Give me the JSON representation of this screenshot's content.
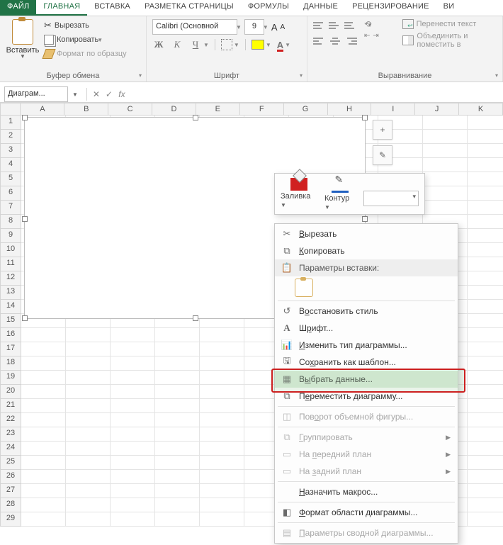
{
  "tabs": {
    "file": "ФАЙЛ",
    "home": "ГЛАВНАЯ",
    "insert": "ВСТАВКА",
    "layout": "РАЗМЕТКА СТРАНИЦЫ",
    "formulas": "ФОРМУЛЫ",
    "data": "ДАННЫЕ",
    "review": "РЕЦЕНЗИРОВАНИЕ",
    "view": "ВИ"
  },
  "ribbon": {
    "clipboard": {
      "paste": "Вставить",
      "cut": "Вырезать",
      "copy": "Копировать",
      "format_painter": "Формат по образцу",
      "group_label": "Буфер обмена"
    },
    "font": {
      "name": "Calibri (Основной",
      "size": "9",
      "group_label": "Шрифт",
      "bold": "Ж",
      "italic": "К",
      "underline": "Ч",
      "grow": "A",
      "shrink": "A",
      "color_letter": "А"
    },
    "align": {
      "wrap": "Перенести текст",
      "merge": "Объединить и поместить в",
      "group_label": "Выравнивание"
    }
  },
  "formula_bar": {
    "namebox": "Диаграм...",
    "fx": "fx"
  },
  "columns": [
    "A",
    "B",
    "C",
    "D",
    "E",
    "F",
    "G",
    "H",
    "I",
    "J",
    "K"
  ],
  "row_count": 29,
  "chart_side": {
    "plus": "+",
    "brush": "✎"
  },
  "mini_toolbar": {
    "fill": "Заливка",
    "outline": "Контур"
  },
  "context_menu": {
    "cut": "Вырезать",
    "copy": "Копировать",
    "paste_options": "Параметры вставки:",
    "reset_style": "Восстановить стиль",
    "font": "Шрифт...",
    "change_chart_type": "Изменить тип диаграммы...",
    "save_template": "Сохранить как шаблон...",
    "select_data": "Выбрать данные...",
    "move_chart": "Переместить диаграмму...",
    "rotate_3d": "Поворот объемной фигуры...",
    "group": "Группировать",
    "bring_front": "На передний план",
    "send_back": "На задний план",
    "assign_macro": "Назначить макрос...",
    "format_chart_area": "Формат области диаграммы...",
    "pivot_chart_options": "Параметры сводной диаграммы..."
  },
  "hotkeys": {
    "cut": "В",
    "copy": "К",
    "reset": "о",
    "font": "р",
    "change": "И",
    "save": "х",
    "select": "ы",
    "move": "е",
    "rotate": "о",
    "group": "Г",
    "front": "п",
    "back": "з",
    "macro": "Н",
    "format": "Ф",
    "pivot": "П"
  }
}
